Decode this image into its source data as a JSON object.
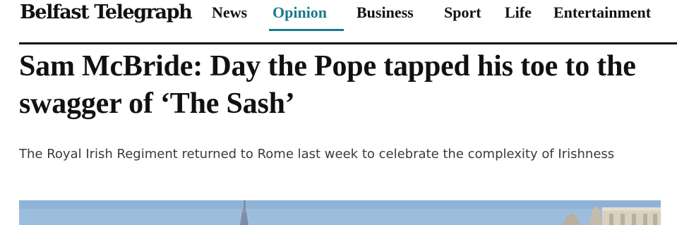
{
  "masthead": {
    "logo_text": "Belfast Telegraph",
    "nav": [
      {
        "label": "News",
        "active": false
      },
      {
        "label": "Opinion",
        "active": true
      },
      {
        "label": "Business",
        "active": false
      },
      {
        "label": "Sport",
        "active": false
      },
      {
        "label": "Life",
        "active": false
      },
      {
        "label": "Entertainment",
        "active": false
      }
    ],
    "accent_color": "#1a7a8a"
  },
  "article": {
    "headline": "Sam McBride: Day the Pope tapped his toe to the swagger of ‘The Sash’",
    "standfirst": "The Royal Irish Regiment returned to Rome last week to celebrate the complexity of Irishness"
  }
}
